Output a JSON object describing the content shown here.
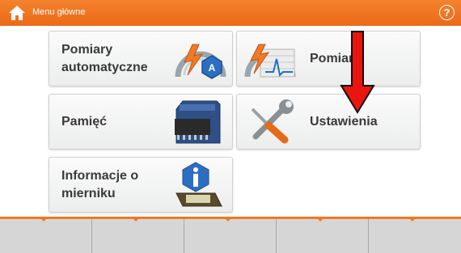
{
  "header": {
    "title": "Menu główne"
  },
  "tiles": {
    "auto": {
      "label_line1": "Pomiary",
      "label_line2": "automatyczne"
    },
    "measurements": {
      "label": "Pomiary"
    },
    "memory": {
      "label": "Pamięć"
    },
    "settings": {
      "label": "Ustawienia"
    },
    "info": {
      "label_line1": "Informacje o",
      "label_line2": "miernik u"
    }
  },
  "colors": {
    "accent": "#ee6f1c",
    "arrow": "#e8160e",
    "tile_text": "#3a3a3a"
  },
  "icons": [
    "home-icon",
    "help-icon",
    "auto-measure-icon",
    "measure-icon",
    "sd-card-icon",
    "tools-icon",
    "info-meter-icon"
  ]
}
